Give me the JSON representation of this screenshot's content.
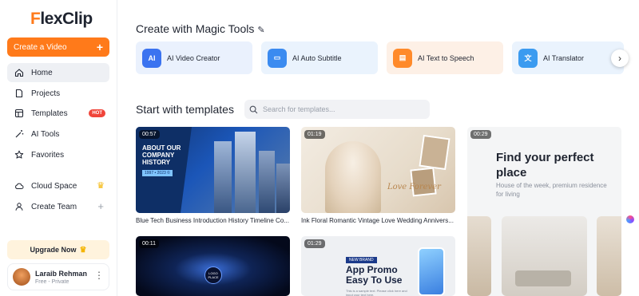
{
  "brand": {
    "logo_text_first": "F",
    "logo_text_rest": "lexClip"
  },
  "sidebar": {
    "create_label": "Create a Video",
    "items": [
      {
        "label": "Home",
        "icon": "home-icon"
      },
      {
        "label": "Projects",
        "icon": "file-icon"
      },
      {
        "label": "Templates",
        "icon": "layout-icon",
        "badge": "HOT"
      },
      {
        "label": "AI Tools",
        "icon": "magic-wand-icon"
      },
      {
        "label": "Favorites",
        "icon": "star-icon"
      },
      {
        "label": "Cloud Space",
        "icon": "cloud-icon"
      },
      {
        "label": "Create Team",
        "icon": "user-icon"
      }
    ],
    "upgrade_label": "Upgrade Now",
    "user": {
      "name": "Laraib Rehman",
      "plan": "Free - Private"
    }
  },
  "magic": {
    "title": "Create with Magic Tools",
    "tools": [
      {
        "label": "AI Video Creator",
        "icon_text": "AI",
        "color": "#3b73f0",
        "bg": "#eaf1fd"
      },
      {
        "label": "AI Auto Subtitle",
        "icon_text": "▭",
        "color": "#3b8bf0",
        "bg": "#eaf3fd"
      },
      {
        "label": "AI Text to Speech",
        "icon_text": "▤",
        "color": "#ff8a2a",
        "bg": "#fdf0e6"
      },
      {
        "label": "AI Translator",
        "icon_text": "文",
        "color": "#3b9bf0",
        "bg": "#eaf3fd"
      }
    ]
  },
  "templates": {
    "title": "Start with templates",
    "search_placeholder": "Search for templates...",
    "cards": [
      {
        "duration": "00:57",
        "title": "Blue Tech Business Introduction History Timeline Co...",
        "overlay": "ABOUT OUR COMPANY HISTORY",
        "tag": "1997 • 2023 ©"
      },
      {
        "duration": "01:19",
        "title": "Ink Floral Romantic Vintage Love Wedding Annivers...",
        "overlay": "Love Forever"
      },
      {
        "duration": "00:29",
        "headline": "Find your perfect place",
        "sub": "House of the week, premium residence for living"
      },
      {
        "duration": "00:11",
        "overlay": "LOGO PLACE"
      },
      {
        "duration": "01:29",
        "brand": "NEW BRAND",
        "headline": "App Promo Easy To Use",
        "small": "This is a sample text. Please click here and input your text here."
      }
    ]
  },
  "colors": {
    "accent": "#ff7a1a",
    "hot": "#f0453a"
  }
}
